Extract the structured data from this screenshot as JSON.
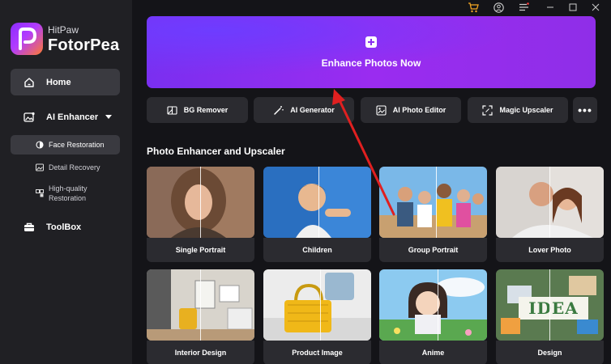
{
  "app": {
    "brand_small": "HitPaw",
    "brand_big": "FotorPea"
  },
  "sidebar": {
    "home": "Home",
    "ai_enhancer": "AI Enhancer",
    "sub_items": {
      "face": "Face Restoration",
      "detail": "Detail Recovery",
      "hq_line1": "High-quality",
      "hq_line2": "Restoration"
    },
    "toolbox": "ToolBox"
  },
  "hero": {
    "label": "Enhance Photos Now"
  },
  "tools": {
    "bg_remover": "BG Remover",
    "ai_generator": "AI Generator",
    "ai_photo_editor": "AI Photo Editor",
    "magic_upscaler": "Magic Upscaler",
    "more": "•••"
  },
  "section": {
    "title": "Photo Enhancer and Upscaler"
  },
  "cards": {
    "single_portrait": "Single Portrait",
    "children": "Children",
    "group_portrait": "Group Portrait",
    "lover_photo": "Lover Photo",
    "interior_design": "Interior Design",
    "product_image": "Product Image",
    "anime": "Anime",
    "design": "Design",
    "design_sign": "IDEA"
  },
  "colors": {
    "accent_purple": "#8a2ef0",
    "sidebar_bg": "#202024",
    "content_bg": "#141418",
    "annotation_arrow": "#e02020"
  },
  "icons": {
    "cart": "cart-icon",
    "user": "user-icon",
    "menu": "menu-icon",
    "minimize": "minimize-icon",
    "maximize": "maximize-icon",
    "close": "close-icon"
  }
}
